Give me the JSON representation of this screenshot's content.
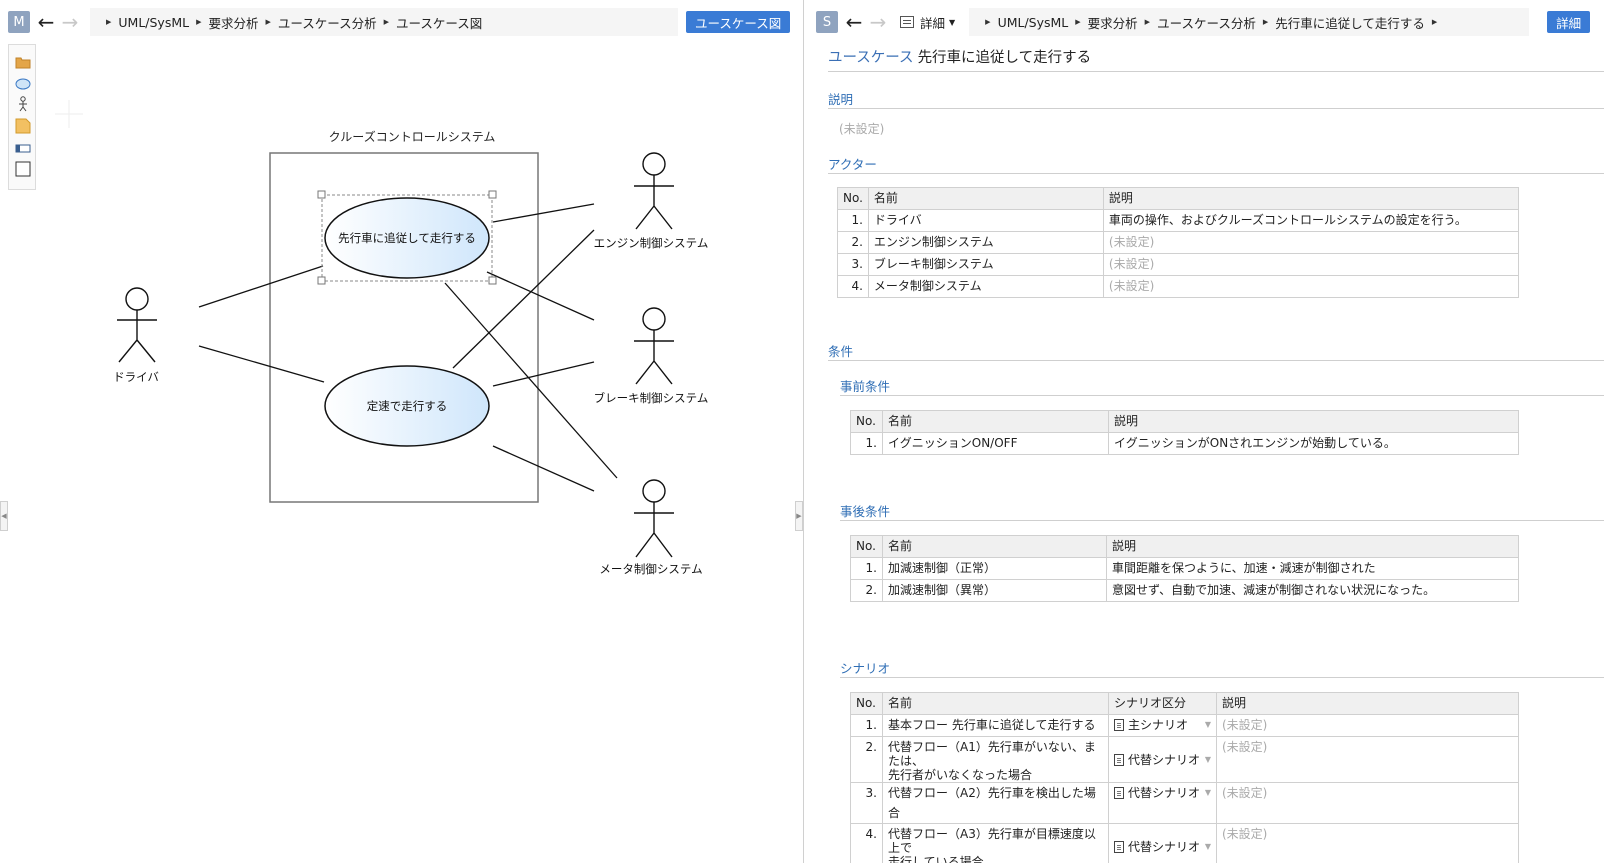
{
  "left": {
    "badge": "M",
    "breadcrumb": [
      "UML/SysML",
      "要求分析",
      "ユースケース分析",
      "ユースケース図"
    ],
    "view_button": "ユースケース図",
    "palette": [
      "package-icon",
      "usecase-icon",
      "actor-icon",
      "note-icon",
      "interface-icon",
      "boundary-icon"
    ],
    "diagram": {
      "system_label": "クルーズコントロールシステム",
      "usecases": [
        "先行車に追従して走行する",
        "定速で走行する"
      ],
      "actors": [
        "ドライバ",
        "エンジン制御システム",
        "ブレーキ制御システム",
        "メータ制御システム"
      ]
    }
  },
  "right": {
    "badge": "S",
    "view_mode": "詳細",
    "breadcrumb": [
      "UML/SysML",
      "要求分析",
      "ユースケース分析",
      "先行車に追従して走行する"
    ],
    "detail_button": "詳細",
    "title_kind": "ユースケース",
    "title_name": "先行車に追従して走行する",
    "description_heading": "説明",
    "description_value": "(未設定)",
    "actors_heading": "アクター",
    "actors_columns": [
      "No.",
      "名前",
      "説明"
    ],
    "actors_rows": [
      {
        "no": "1.",
        "name": "ドライバ",
        "desc": "車両の操作、およびクルーズコントロールシステムの設定を行う。"
      },
      {
        "no": "2.",
        "name": "エンジン制御システム",
        "desc": "(未設定)"
      },
      {
        "no": "3.",
        "name": "ブレーキ制御システム",
        "desc": "(未設定)"
      },
      {
        "no": "4.",
        "name": "メータ制御システム",
        "desc": "(未設定)"
      }
    ],
    "conditions_heading": "条件",
    "pre_heading": "事前条件",
    "pre_columns": [
      "No.",
      "名前",
      "説明"
    ],
    "pre_rows": [
      {
        "no": "1.",
        "name": "イグニッションON/OFF",
        "desc": "イグニッションがONされエンジンが始動している。"
      }
    ],
    "post_heading": "事後条件",
    "post_columns": [
      "No.",
      "名前",
      "説明"
    ],
    "post_rows": [
      {
        "no": "1.",
        "name": "加減速制御（正常）",
        "desc": "車間距離を保つように、加速・減速が制御された"
      },
      {
        "no": "2.",
        "name": "加減速制御（異常）",
        "desc": "意図せず、自動で加速、減速が制御されない状況になった。"
      }
    ],
    "scenario_heading": "シナリオ",
    "scenario_columns": [
      "No.",
      "名前",
      "シナリオ区分",
      "説明"
    ],
    "scenario_rows": [
      {
        "no": "1.",
        "name1": "基本フロー 先行車に追従して走行する",
        "name2": "",
        "type": "主シナリオ",
        "desc": "(未設定)"
      },
      {
        "no": "2.",
        "name1": "代替フロー（A1）先行車がいない、または、",
        "name2": "先行者がいなくなった場合",
        "type": "代替シナリオ",
        "desc": "(未設定)"
      },
      {
        "no": "3.",
        "name1": "代替フロー（A2）先行車を検出した場合",
        "name2": "",
        "type": "代替シナリオ",
        "desc": "(未設定)"
      },
      {
        "no": "4.",
        "name1": "代替フロー（A3）先行車が目標速度以上で",
        "name2": "走行している場合",
        "type": "代替シナリオ",
        "desc": "(未設定)"
      }
    ]
  }
}
